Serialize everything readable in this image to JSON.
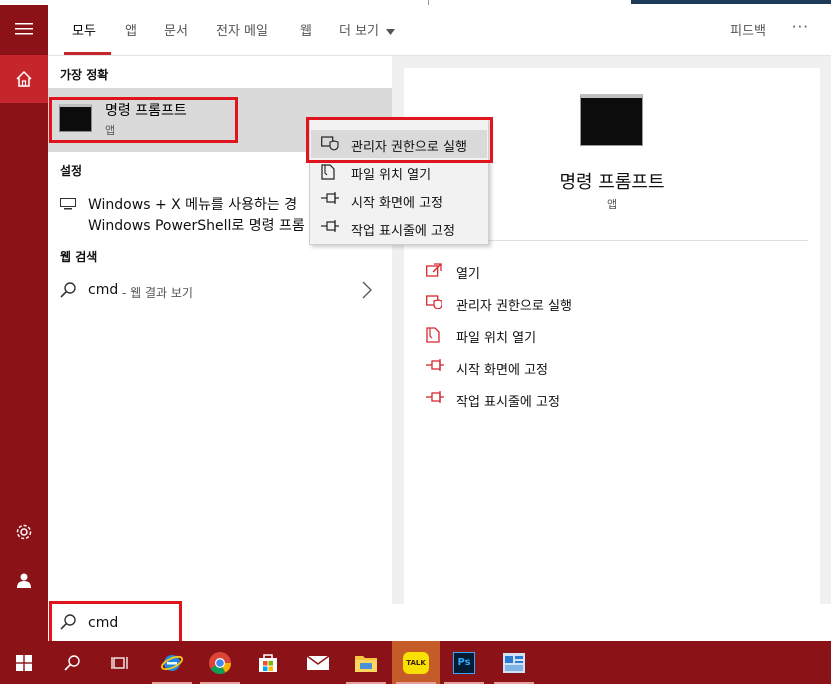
{
  "tabs": [
    {
      "label": "모두"
    },
    {
      "label": "앱"
    },
    {
      "label": "문서"
    },
    {
      "label": "전자 메일"
    },
    {
      "label": "웹"
    },
    {
      "label": "더 보기"
    }
  ],
  "header": {
    "feedback": "피드백",
    "more": "···"
  },
  "results": {
    "best_match_header": "가장 정확",
    "best_match": {
      "title": "명령 프롬프트",
      "subtitle": "앱"
    },
    "settings_header": "설정",
    "setting_line1": "Windows + X 메뉴를 사용하는 경",
    "setting_line2": "Windows PowerShell로 명령 프롬",
    "web_header": "웹 검색",
    "web_query": "cmd",
    "web_suffix": " - 웹 결과 보기"
  },
  "context_menu": [
    {
      "label": "관리자 권한으로 실행",
      "icon": "shield-icon"
    },
    {
      "label": "파일 위치 열기",
      "icon": "file-icon"
    },
    {
      "label": "시작 화면에 고정",
      "icon": "pin-icon"
    },
    {
      "label": "작업 표시줄에 고정",
      "icon": "pin-icon"
    }
  ],
  "detail": {
    "title": "명령 프롬프트",
    "subtitle": "앱",
    "actions": [
      {
        "label": "열기",
        "icon": "open-icon"
      },
      {
        "label": "관리자 권한으로 실행",
        "icon": "shield-icon"
      },
      {
        "label": "파일 위치 열기",
        "icon": "file-icon"
      },
      {
        "label": "시작 화면에 고정",
        "icon": "pin-icon"
      },
      {
        "label": "작업 표시줄에 고정",
        "icon": "pin-icon"
      }
    ]
  },
  "search": {
    "value": "cmd"
  },
  "taskbar": {
    "items": [
      "windows-start-icon",
      "search-icon",
      "task-view-icon",
      "internet-explorer-icon",
      "chrome-icon",
      "store-icon",
      "mail-icon",
      "file-explorer-icon",
      "kakaotalk-icon",
      "photoshop-icon",
      "app-icon"
    ],
    "kakao_label": "TALK",
    "ps_label": "Ps"
  },
  "colors": {
    "accent": "#c5262c",
    "rail": "#8b1317",
    "highlight": "#e0141c"
  }
}
